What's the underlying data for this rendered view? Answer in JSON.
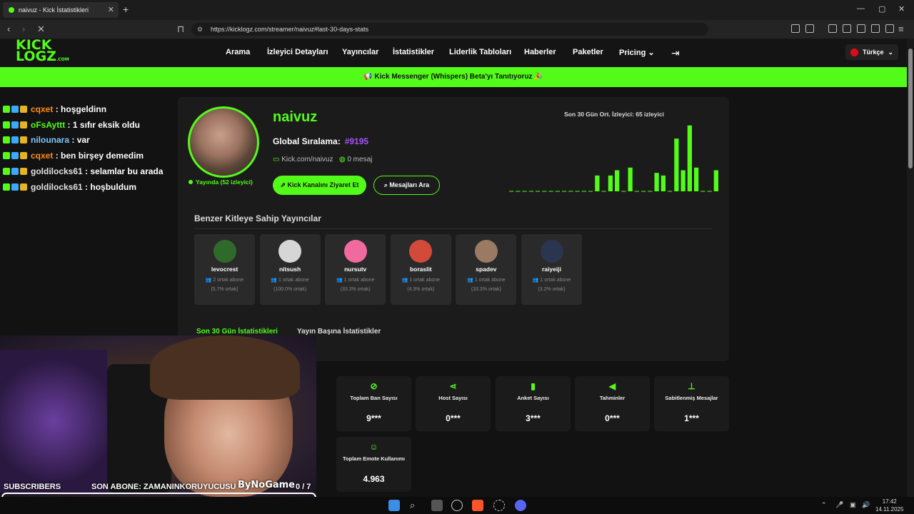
{
  "browser": {
    "tab_title": "naivuz - Kick İstatistikleri",
    "url": "https://kicklogz.com/streamer/naivuz#last-30-days-stats",
    "newtab_glyph": "+",
    "close_glyph": "✕"
  },
  "site": {
    "logo_line1": "KICK",
    "logo_line2": "LOGZ",
    "logo_suffix": ".COM",
    "nav": [
      "Arama",
      "İzleyici Detayları",
      "Yayıncılar",
      "İstatistikler",
      "Liderlik Tabloları",
      "Haberler",
      "Paketler",
      "Pricing"
    ],
    "language": "Türkçe",
    "banner": "Kick Messenger (Whispers) Beta'yı Tanıtıyoruz 🎉"
  },
  "chat": [
    {
      "user": "cqxet",
      "msg": "hoşgeldinn",
      "color": "#ff8c1a"
    },
    {
      "user": "oFsAyttt",
      "msg": "1 sıfır eksik oldu",
      "color": "#53fc18"
    },
    {
      "user": "nilounara",
      "msg": "var",
      "color": "#7ec8ff"
    },
    {
      "user": "cqxet",
      "msg": "ben birşey demedim",
      "color": "#ff8c1a"
    },
    {
      "user": "goldilocks61",
      "msg": "selamlar bu arada",
      "color": "#e2e2e2"
    },
    {
      "user": "goldilocks61",
      "msg": "hoşbuldum",
      "color": "#e2e2e2"
    }
  ],
  "profile": {
    "name": "naivuz",
    "rank_label": "Global Sıralama:",
    "rank_value": "#9195",
    "kick_link": "Kick.com/naivuz",
    "messages": "0 mesaj",
    "live": "Yayında (52 izleyici)",
    "visit_button": "Kick Kanalını Ziyaret Et",
    "search_button": "Mesajları Ara"
  },
  "chart_data": {
    "type": "bar",
    "title": "Son 30 Gün Ort. İzleyici: 65 izleyici",
    "values": [
      0,
      0,
      0,
      0,
      0,
      0,
      0,
      0,
      0,
      0,
      0,
      0,
      0,
      30,
      0,
      30,
      40,
      0,
      45,
      0,
      0,
      0,
      35,
      30,
      0,
      100,
      40,
      125,
      45,
      0,
      0,
      40
    ],
    "ylim": [
      0,
      130
    ],
    "color": "#53fc18"
  },
  "similar": {
    "title": "Benzer Kitleye Sahip Yayıncılar",
    "items": [
      {
        "name": "levocrest",
        "sub": "2 ortak abone",
        "pct": "(5.7% ortak)",
        "color": "#2f6a2a"
      },
      {
        "name": "nitsush",
        "sub": "1 ortak abone",
        "pct": "(100.0% ortak)",
        "color": "#d6d6d6"
      },
      {
        "name": "nursutv",
        "sub": "1 ortak abone",
        "pct": "(33.3% ortak)",
        "color": "#f06aa0"
      },
      {
        "name": "boraslit",
        "sub": "1 ortak abone",
        "pct": "(4.3% ortak)",
        "color": "#d24a3a"
      },
      {
        "name": "spadev",
        "sub": "1 ortak abone",
        "pct": "(33.3% ortak)",
        "color": "#9a7a62"
      },
      {
        "name": "raiyeiji",
        "sub": "1 ortak abone",
        "pct": "(3.2% ortak)",
        "color": "#2a3550"
      }
    ]
  },
  "tabs": {
    "active": "Son 30 Gün İstatistikleri",
    "inactive": "Yayın Başına İstatistikler"
  },
  "stats": [
    {
      "icon": "⊘",
      "label": "Toplam Ban Sayısı",
      "value": "9***"
    },
    {
      "icon": "⋖",
      "label": "Host Sayısı",
      "value": "0***"
    },
    {
      "icon": "▮",
      "label": "Anket Sayısı",
      "value": "3***"
    },
    {
      "icon": "◀",
      "label": "Tahminler",
      "value": "0***"
    },
    {
      "icon": "⊥",
      "label": "Sabitlenmiş Mesajlar",
      "value": "1***"
    },
    {
      "icon": "☺",
      "label": "Toplam Emote Kullanımı",
      "value": "4.963"
    }
  ],
  "overlay": {
    "subscribers": "SUBSCRIBERS",
    "last_sub": "SON ABONE: ZAMANINKORUYUCUSU",
    "brand": "ByNoGame",
    "count": "0 / 7",
    "progress": 0
  },
  "taskbar": {
    "time": "17:42",
    "date": "14.11.2025"
  }
}
